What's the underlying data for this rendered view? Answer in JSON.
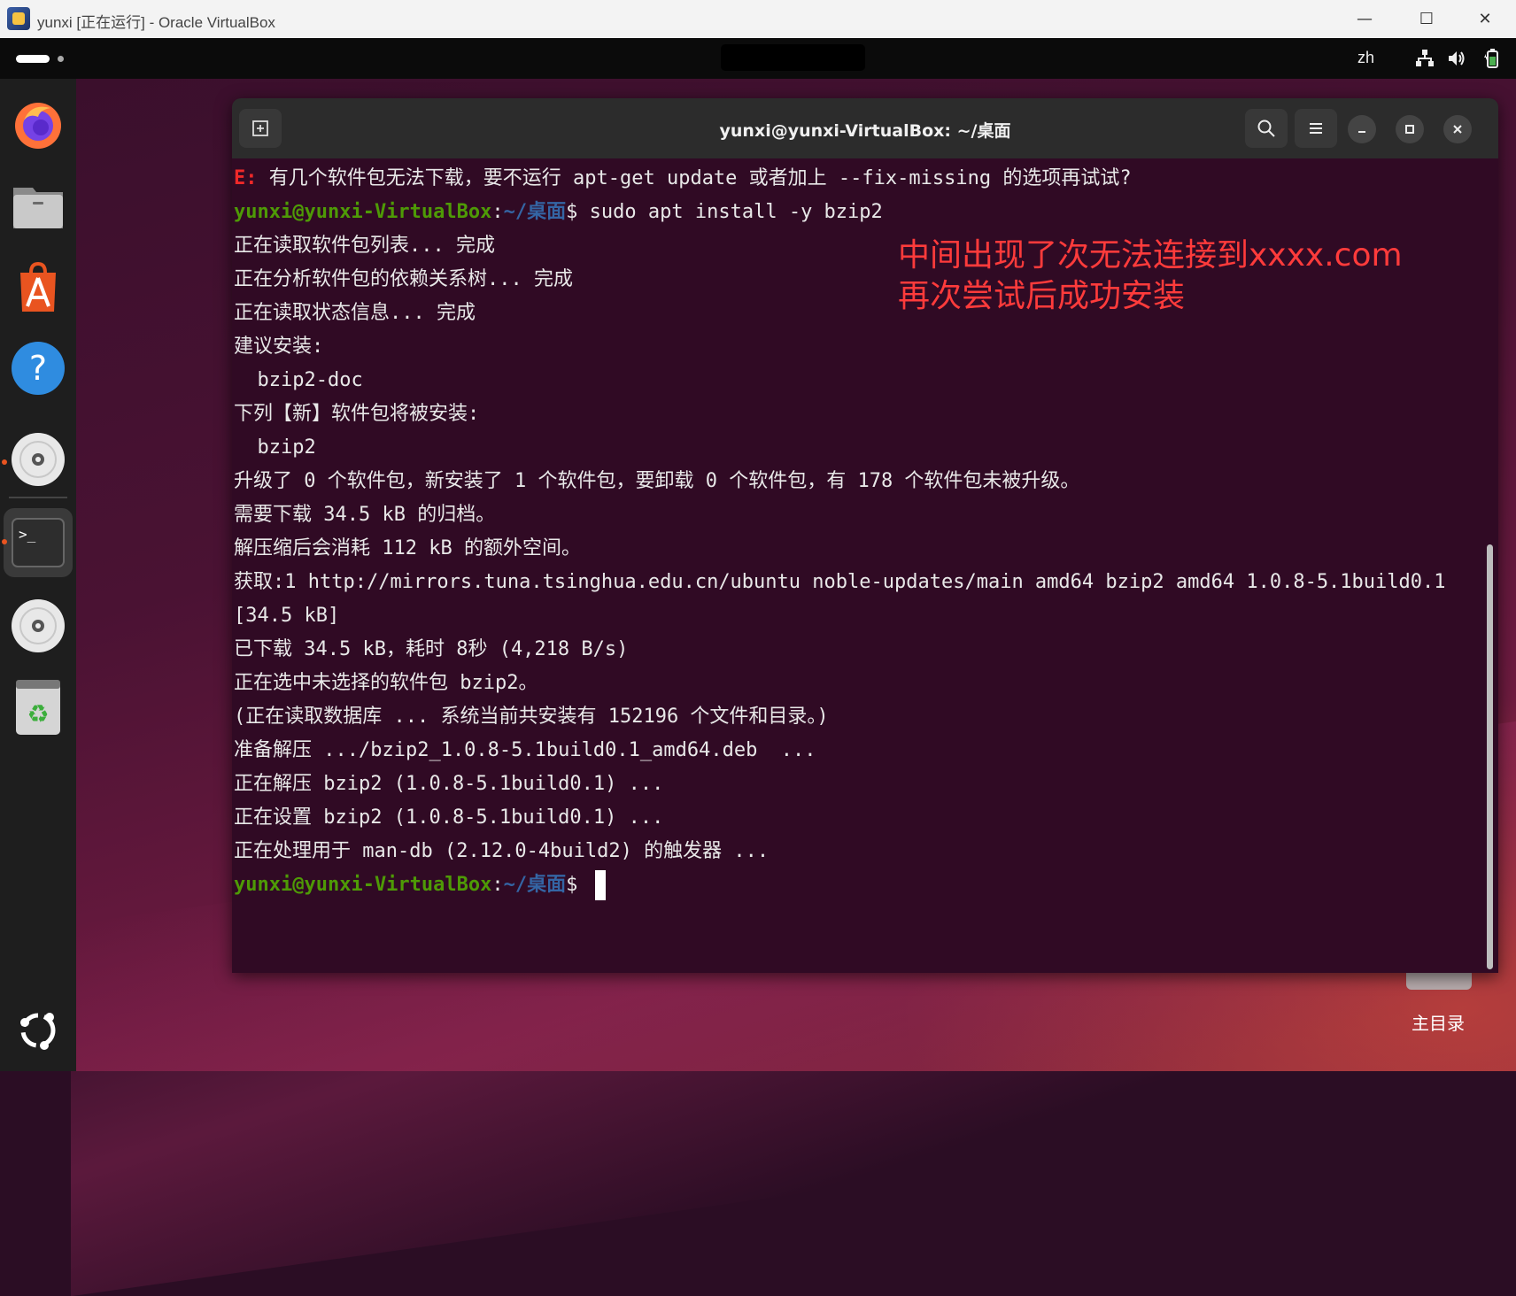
{
  "host": {
    "title": "yunxi [正在运行] - Oracle VirtualBox",
    "controls": {
      "minimize": "—",
      "maximize": "☐",
      "close": "✕"
    }
  },
  "top_bar": {
    "language": "zh",
    "tray_icons": [
      "network-icon",
      "volume-icon",
      "battery-icon"
    ]
  },
  "dock": {
    "items": [
      "firefox-icon",
      "files-icon",
      "app-center-icon",
      "help-icon",
      "disc-icon",
      "terminal-icon",
      "disc-icon",
      "trash-icon"
    ],
    "show_apps_icon": "ubuntu-logo-icon"
  },
  "desktop": {
    "home_label": "主目录"
  },
  "terminal": {
    "title": "yunxi@yunxi-VirtualBox: ~/桌面",
    "prompt_user": "yunxi@yunxi-VirtualBox",
    "prompt_colon": ":",
    "prompt_path": "~/桌面",
    "prompt_symbol": "$ ",
    "err_prefix": "E:",
    "err_text": " 有几个软件包无法下载，要不运行 apt-get update 或者加上 --fix-missing 的选项再试试?",
    "command": "sudo apt install -y bzip2",
    "output": [
      "正在读取软件包列表... 完成",
      "正在分析软件包的依赖关系树... 完成",
      "正在读取状态信息... 完成",
      "建议安装:",
      "  bzip2-doc",
      "下列【新】软件包将被安装:",
      "  bzip2",
      "升级了 0 个软件包，新安装了 1 个软件包，要卸载 0 个软件包，有 178 个软件包未被升级。",
      "需要下载 34.5 kB 的归档。",
      "解压缩后会消耗 112 kB 的额外空间。",
      "获取:1 http://mirrors.tuna.tsinghua.edu.cn/ubuntu noble-updates/main amd64 bzip2 amd64 1.0.8-5.1build0.1",
      "[34.5 kB]",
      "已下载 34.5 kB，耗时 8秒 (4,218 B/s)",
      "正在选中未选择的软件包 bzip2。",
      "(正在读取数据库 ... 系统当前共安装有 152196 个文件和目录。)",
      "准备解压 .../bzip2_1.0.8-5.1build0.1_amd64.deb  ...",
      "正在解压 bzip2 (1.0.8-5.1build0.1) ...",
      "正在设置 bzip2 (1.0.8-5.1build0.1) ...",
      "正在处理用于 man-db (2.12.0-4build2) 的触发器 ..."
    ]
  },
  "annotation": {
    "line1": "中间出现了次无法连接到xxxx.com",
    "line2": "再次尝试后成功安装"
  },
  "colors": {
    "terminal_bg": "#300a24",
    "prompt_user": "#4e9a06",
    "prompt_path": "#3465a4",
    "error": "#ef2929",
    "annotation": "#ff3b3b"
  }
}
